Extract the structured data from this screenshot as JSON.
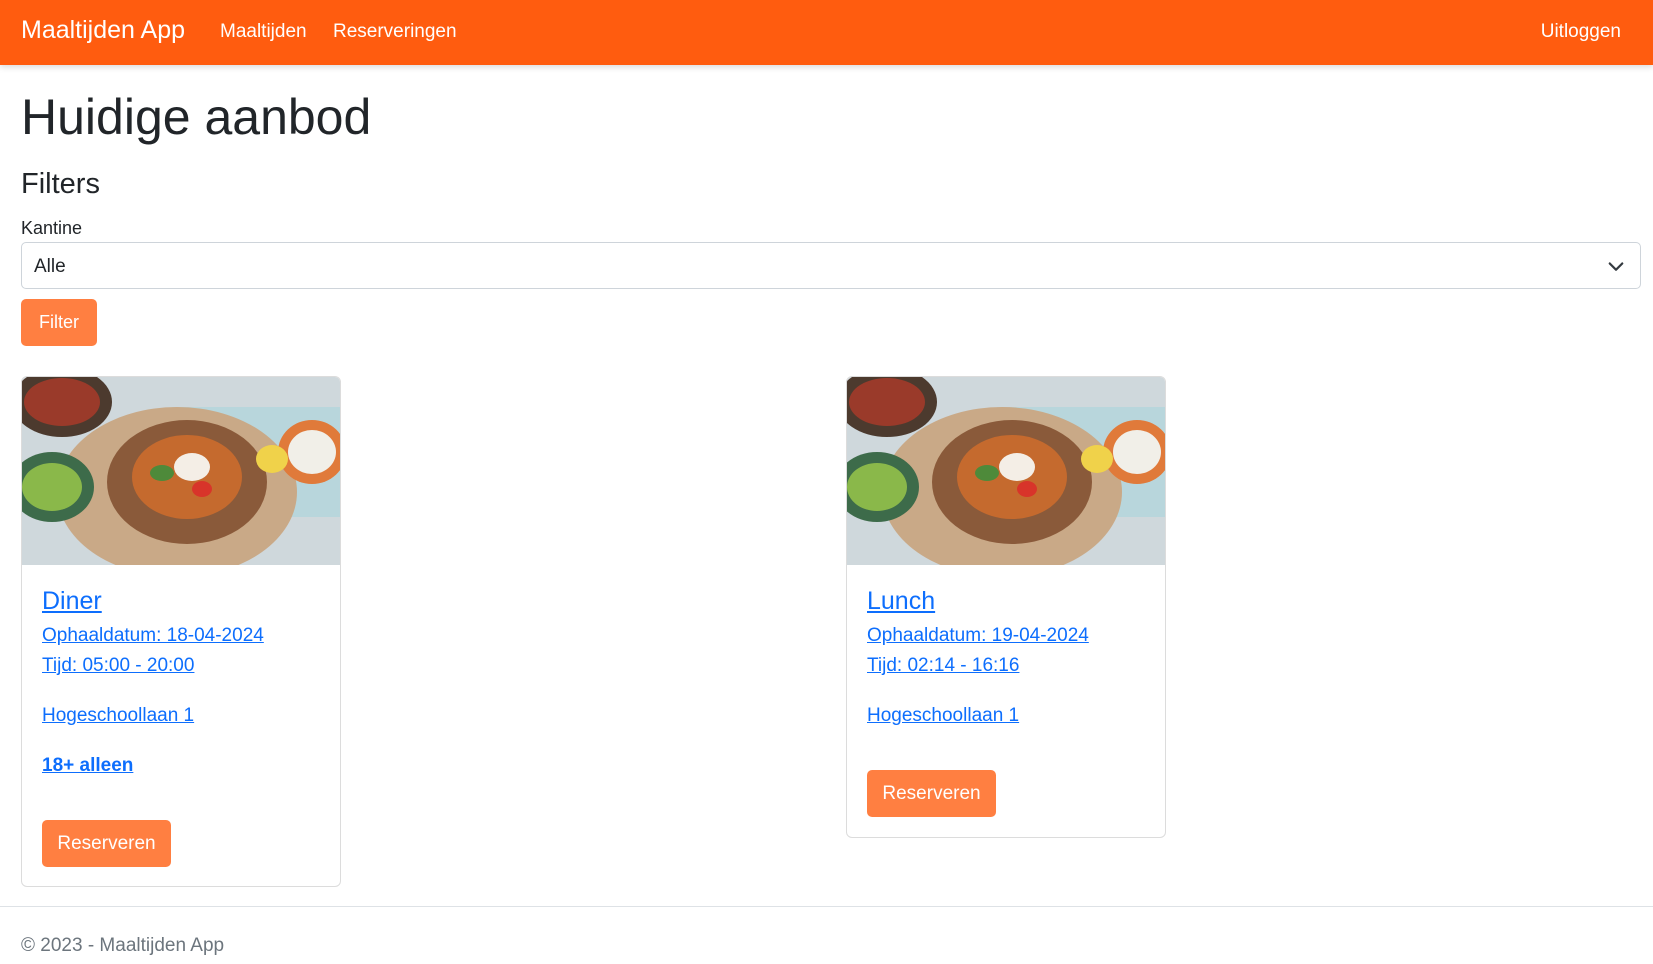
{
  "nav": {
    "brand": "Maaltijden App",
    "links": [
      "Maaltijden",
      "Reserveringen"
    ],
    "logout": "Uitloggen"
  },
  "page": {
    "title": "Huidige aanbod",
    "filters_title": "Filters",
    "kantine_label": "Kantine",
    "kantine_value": "Alle",
    "filter_button": "Filter"
  },
  "meals": [
    {
      "title": "Diner",
      "date": "Ophaaldatum: 18-04-2024",
      "time": "Tijd: 05:00 - 20:00",
      "address": "Hogeschoollaan 1",
      "age": "18+ alleen",
      "button": "Reserveren"
    },
    {
      "title": "Lunch",
      "date": "Ophaaldatum: 19-04-2024",
      "time": "Tijd: 02:14 - 16:16",
      "address": "Hogeschoollaan 1",
      "button": "Reserveren"
    }
  ],
  "footer": "© 2023 - Maaltijden App",
  "colors": {
    "navbar": "#ff5c0f",
    "button": "#ff7f41",
    "link": "#0d6efd"
  }
}
